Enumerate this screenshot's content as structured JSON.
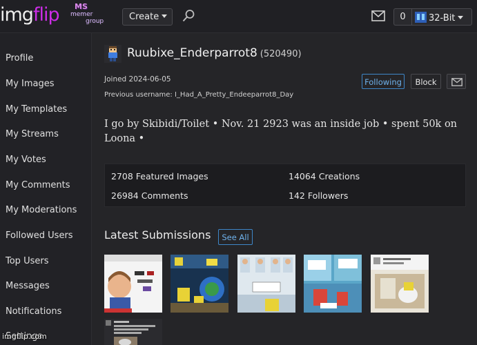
{
  "header": {
    "logo_part1": "img",
    "logo_part2": "flip",
    "stream_logo": {
      "line1": "MS",
      "line2": "memer",
      "line3": "group"
    },
    "create_label": "Create",
    "notification_count": "0",
    "user_label": "32-Bit"
  },
  "sidebar": {
    "items": [
      {
        "label": "Profile"
      },
      {
        "label": "My Images"
      },
      {
        "label": "My Templates"
      },
      {
        "label": "My Streams"
      },
      {
        "label": "My Votes"
      },
      {
        "label": "My Comments"
      },
      {
        "label": "My Moderations"
      },
      {
        "label": "Followed Users"
      },
      {
        "label": "Top Users"
      },
      {
        "label": "Messages"
      },
      {
        "label": "Notifications"
      },
      {
        "label": "Settings"
      }
    ]
  },
  "profile": {
    "username": "Ruubixe_Enderparrot8",
    "points": "(520490)",
    "joined": "Joined 2024-06-05",
    "previous_username": "Previous username: I_Had_A_Pretty_Endeeparrot8_Day",
    "following_label": "Following",
    "block_label": "Block",
    "bio": "I go by Skibidi/Toilet • Nov. 21 2923 was an inside job • spent 50k on Loona •"
  },
  "stats": {
    "featured": "2708 Featured Images",
    "creations": "14064 Creations",
    "comments": "26984 Comments",
    "followers": "142 Followers"
  },
  "latest": {
    "title": "Latest Submissions",
    "see_all_label": "See All"
  },
  "watermark": "imgflip.com",
  "colors": {
    "background": "#252528",
    "topbar": "#202024",
    "brand_purple": "#cc2de6",
    "accent_blue": "#3e87c9"
  },
  "icons": [
    "search-icon",
    "mail-icon",
    "envelope-icon",
    "caret-down-icon"
  ]
}
